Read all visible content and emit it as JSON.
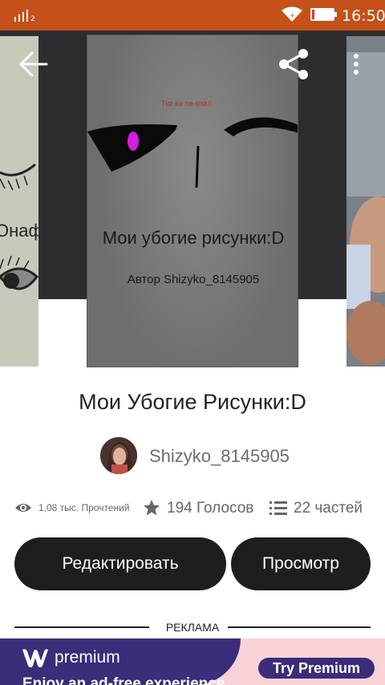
{
  "status_bar": {
    "battery_label": "11",
    "battery_level": 0.11,
    "time": "16:50"
  },
  "cover": {
    "title_text": "Мои убогие рисунки:D",
    "author_text": "Автор Shizyko_8145905",
    "small_red_text": "Tuz-ka ne-sisk!!",
    "left_cover_text": "Онаф"
  },
  "story": {
    "title": "Мои Убогие Рисунки:D",
    "author": "Shizyko_8145905",
    "stats": {
      "reads": "1,08 тыс. Прочтений",
      "votes": "194 Голосов",
      "parts": "22 частей"
    }
  },
  "actions": {
    "edit_label": "Редактировать",
    "view_label": "Просмотр"
  },
  "ad": {
    "divider_label": "РЕКЛАМА",
    "brand": "premium",
    "tagline": "Enjoy an ad-free experience",
    "cta": "Try Premium"
  },
  "icons": [
    "signal-icon",
    "wifi-icon",
    "battery-icon",
    "back-arrow-icon",
    "share-icon",
    "more-vert-icon",
    "eye-icon",
    "star-icon",
    "list-icon",
    "wattpad-w-icon"
  ],
  "colors": {
    "status_bar": "#c4501a",
    "button_bg": "#1f1d1e",
    "ad_purple": "#3a2d7a",
    "ad_pink": "#f9d3d8"
  }
}
